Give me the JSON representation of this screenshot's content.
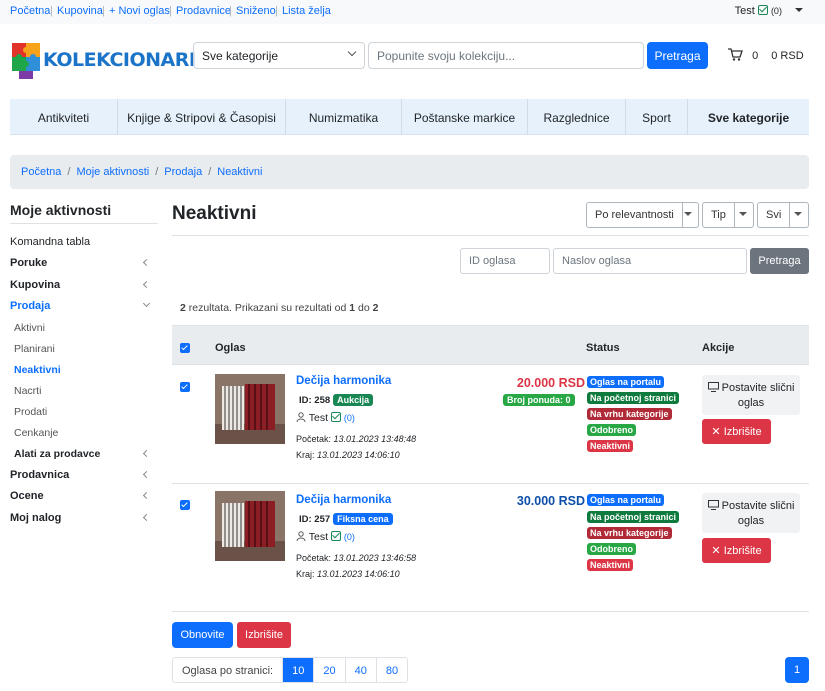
{
  "topbar": {
    "links": [
      "Početna",
      "Kupovina",
      "+ Novi oglas",
      "Prodavnice",
      "Sniženo",
      "Lista želja"
    ],
    "user": "Test",
    "user_count": "(0)"
  },
  "header": {
    "logo_text": "Kolekcionari",
    "category_select": "Sve kategorije",
    "search_placeholder": "Popunite svoju kolekciju...",
    "search_button": "Pretraga",
    "cart_count": "0",
    "cart_total": "0 RSD"
  },
  "categories": [
    "Antikviteti",
    "Knjige & Stripovi & Časopisi",
    "Numizmatika",
    "Poštanske markice",
    "Razglednice",
    "Sport",
    "Sve kategorije"
  ],
  "breadcrumb": [
    "Početna",
    "Moje aktivnosti",
    "Prodaja",
    "Neaktivni"
  ],
  "sidebar": {
    "title": "Moje aktivnosti",
    "items": [
      {
        "label": "Komandna tabla"
      },
      {
        "label": "Poruke"
      },
      {
        "label": "Kupovina"
      },
      {
        "label": "Prodaja"
      },
      {
        "label": "Aktivni"
      },
      {
        "label": "Planirani"
      },
      {
        "label": "Neaktivni"
      },
      {
        "label": "Nacrti"
      },
      {
        "label": "Prodati"
      },
      {
        "label": "Cenkanje"
      },
      {
        "label": "Alati za prodavce"
      },
      {
        "label": "Prodavnica"
      },
      {
        "label": "Ocene"
      },
      {
        "label": "Moj nalog"
      }
    ]
  },
  "main": {
    "title": "Neaktivni",
    "sort": "Po relevantnosti",
    "type": "Tip",
    "all": "Svi",
    "id_placeholder": "ID oglasa",
    "name_placeholder": "Naslov oglasa",
    "filter_button": "Pretraga",
    "results": {
      "count": "2",
      "text1": " rezultata. Prikazani su rezultati od ",
      "from": "1",
      "text2": " do ",
      "to": "2"
    },
    "columns": {
      "ad": "Oglas",
      "status": "Status",
      "actions": "Akcije"
    },
    "rows": [
      {
        "title": "Dečija harmonika",
        "id": "ID: 258",
        "type": "Aukcija",
        "type_color": "#198754",
        "user": "Test",
        "user_count": "(0)",
        "start_label": "Početak:",
        "start": "13.01.2023 13:48:48",
        "end_label": "Kraj:",
        "end": "13.01.2023 14:06:10",
        "price": "20.000 RSD",
        "price_color": "#dc3545",
        "bids": "Broj ponuda: 0",
        "statuses": [
          "Oglas na portalu",
          "Na početnoj stranici",
          "Na vrhu kategorije",
          "Odobreno",
          "Neaktivni"
        ],
        "similar": "Postavite sličnі oglas",
        "delete": "Izbrišite"
      },
      {
        "title": "Dečija harmonika",
        "id": "ID: 257",
        "type": "Fiksna cena",
        "type_color": "#0d6efd",
        "user": "Test",
        "user_count": "(0)",
        "start_label": "Početak:",
        "start": "13.01.2023 13:46:58",
        "end_label": "Kraj:",
        "end": "13.01.2023 14:06:10",
        "price": "30.000 RSD",
        "price_color": "#0d4fa8",
        "statuses": [
          "Oglas na portalu",
          "Na početnoj stranici",
          "Na vrhu kategorije",
          "Odobreno",
          "Neaktivni"
        ],
        "similar": "Postavite sličnі oglas",
        "delete": "Izbrišite"
      }
    ],
    "renew_button": "Obnovite",
    "delete_button": "Izbrišite",
    "per_page_label": "Oglasa po stranici:",
    "per_page_options": [
      "10",
      "20",
      "40",
      "80"
    ],
    "current_page": "1"
  },
  "status_colors": [
    "#0d6efd",
    "#0f7a3d",
    "#b02a37",
    "#28a745",
    "#dc3545"
  ]
}
